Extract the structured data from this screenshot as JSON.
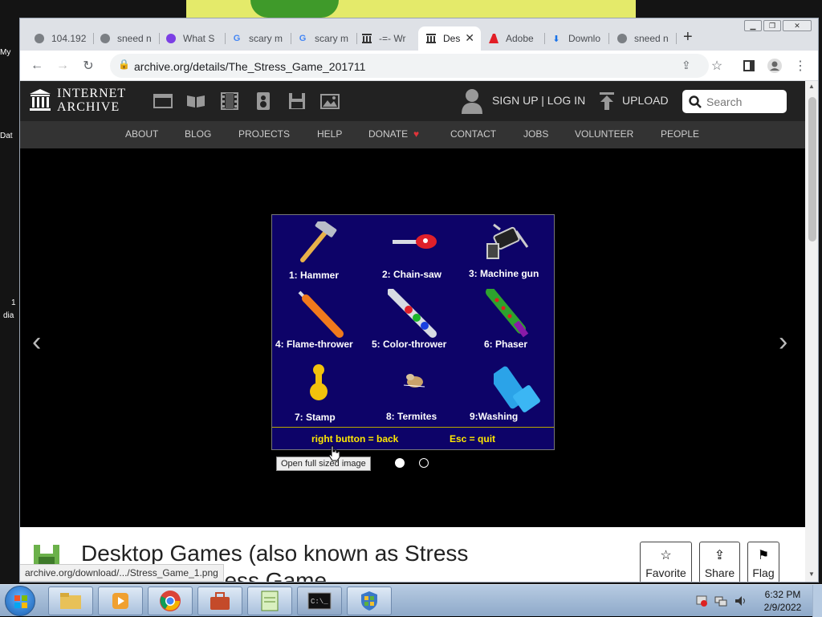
{
  "desktop": {
    "labels": [
      "My",
      "Dat",
      "1",
      "dia"
    ]
  },
  "browser": {
    "tabs": [
      {
        "label": "104.192",
        "icon": "globe-icon"
      },
      {
        "label": "sneed n",
        "icon": "globe-icon"
      },
      {
        "label": "What S",
        "icon": "picsart-icon"
      },
      {
        "label": "scary m",
        "icon": "google-icon"
      },
      {
        "label": "scary m",
        "icon": "google-icon"
      },
      {
        "label": "-=- Wr",
        "icon": "archive-icon"
      },
      {
        "label": "Des",
        "icon": "archive-icon",
        "active": true
      },
      {
        "label": "Adobe",
        "icon": "adobe-icon"
      },
      {
        "label": "Downlo",
        "icon": "download-icon"
      },
      {
        "label": "sneed n",
        "icon": "globe-icon"
      }
    ],
    "new_tab_label": "+",
    "url": "archive.org/details/The_Stress_Game_201711",
    "status_url": "archive.org/download/.../Stress_Game_1.png"
  },
  "ia": {
    "logo_line1": "INTERNET",
    "logo_line2": "ARCHIVE",
    "signup": "SIGN UP | LOG IN",
    "upload": "UPLOAD",
    "search_placeholder": "Search",
    "nav": [
      "ABOUT",
      "BLOG",
      "PROJECTS",
      "HELP",
      "DONATE",
      "CONTACT",
      "JOBS",
      "VOLUNTEER",
      "PEOPLE"
    ],
    "donate_heart": "♥",
    "prev_arrow": "‹",
    "next_arrow": "›",
    "tooltip": "Open full sized image",
    "item_title_line1": "Desktop Games (also known as Stress",
    "item_title_line2": "Relief, The Stress Game",
    "actions": [
      {
        "label": "Favorite",
        "icon": "star-icon",
        "glyph": "☆"
      },
      {
        "label": "Share",
        "icon": "share-icon",
        "glyph": "⇪"
      },
      {
        "label": "Flag",
        "icon": "flag-icon",
        "glyph": "⚑"
      }
    ]
  },
  "game": {
    "weapons": [
      "1: Hammer",
      "2: Chain-saw",
      "3: Machine gun",
      "4: Flame-thrower",
      "5: Color-thrower",
      "6: Phaser",
      "7: Stamp",
      "8: Termites",
      "9:Washing"
    ],
    "footer_left": "right button = back",
    "footer_right": "Esc = quit"
  },
  "taskbar": {
    "time": "6:32 PM",
    "date": "2/9/2022"
  },
  "colors": {
    "game_bg": "#0d0368",
    "game_footer_text": "#ffe800",
    "ia_header": "#222222",
    "ia_nav": "#333333"
  }
}
